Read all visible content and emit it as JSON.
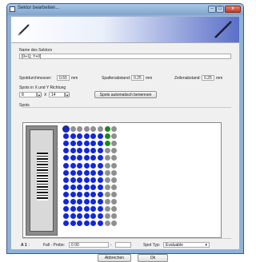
{
  "window": {
    "title": "Sektor bearbeiten..."
  },
  "titlebar_buttons": {
    "minimize": "–",
    "maximize": "□",
    "close": "x"
  },
  "sector": {
    "name_label": "Name des Sektors",
    "name_value": "[0+1]; Y+0]"
  },
  "params": {
    "spot_diameter_label": "Spotdurchmesser:",
    "spot_diameter_value": "0.55",
    "spot_diameter_unit": "mm",
    "col_spacing_label": "Spaltenabstand:",
    "col_spacing_value": "0.25",
    "col_spacing_unit": "mm",
    "row_spacing_label": "Zeilenabstand:",
    "row_spacing_value": "0.25",
    "row_spacing_unit": "mm"
  },
  "spots_xy": {
    "label": "Spots in X und Y Richtung",
    "x_value": "8",
    "times": "X",
    "y_value": "14",
    "auto_name_button": "Spots automatisch benennen"
  },
  "spots_section": {
    "label": "Spots"
  },
  "grid": {
    "columns": 8,
    "rows": 14,
    "active_colors": {
      "blue": "#1227d8",
      "green": "#1a8a1a",
      "gray": "#8f8f8f",
      "selected_ring": "#2a2a2a"
    }
  },
  "bottom": {
    "spot_id": "A 1",
    "colon": ":",
    "fall_probe_label": "Fall - Probe:",
    "fall_probe_value": "0 00",
    "dash": "-",
    "spot_typ_label": "Spot Typ:",
    "spot_typ_value": "Evaluable"
  },
  "footer": {
    "cancel": "Abbrechen",
    "ok": "Ok"
  }
}
